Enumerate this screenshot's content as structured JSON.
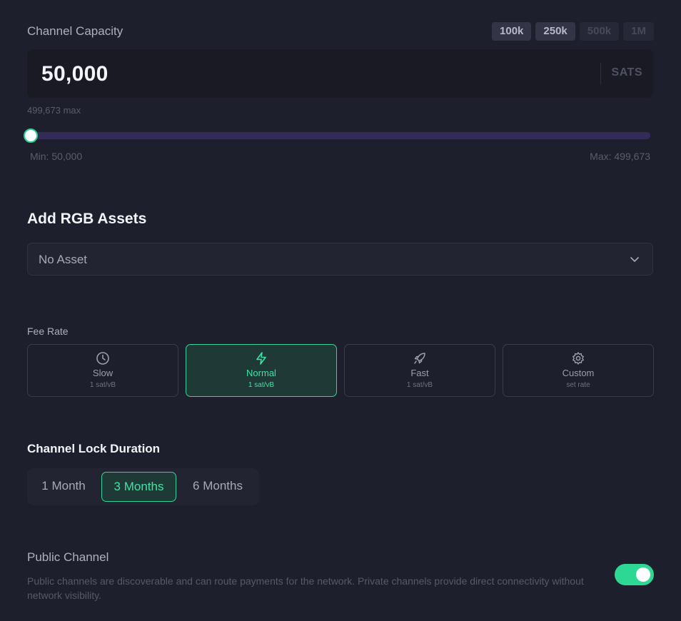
{
  "capacity": {
    "label": "Channel Capacity",
    "presets": [
      {
        "label": "100k",
        "enabled": true
      },
      {
        "label": "250k",
        "enabled": true
      },
      {
        "label": "500k",
        "enabled": false
      },
      {
        "label": "1M",
        "enabled": false
      }
    ],
    "value": "50,000",
    "unit": "SATS",
    "max_hint": "499,673 max",
    "slider": {
      "fraction": 0.0
    },
    "min_label": "Min: 50,000",
    "max_label": "Max: 499,673"
  },
  "rgb": {
    "title": "Add RGB Assets",
    "selected": "No Asset"
  },
  "fee": {
    "label": "Fee Rate",
    "options": [
      {
        "name": "Slow",
        "rate": "1 sat/vB",
        "icon": "clock-icon",
        "active": false
      },
      {
        "name": "Normal",
        "rate": "1 sat/vB",
        "icon": "lightning-icon",
        "active": true
      },
      {
        "name": "Fast",
        "rate": "1 sat/vB",
        "icon": "rocket-icon",
        "active": false
      },
      {
        "name": "Custom",
        "rate": "set rate",
        "icon": "gear-icon",
        "active": false
      }
    ]
  },
  "lock": {
    "title": "Channel Lock Duration",
    "options": [
      {
        "label": "1 Month",
        "active": false
      },
      {
        "label": "3 Months",
        "active": true
      },
      {
        "label": "6 Months",
        "active": false
      }
    ]
  },
  "public": {
    "title": "Public Channel",
    "description": "Public channels are discoverable and can route payments for the network. Private channels provide direct connectivity without network visibility.",
    "enabled": true
  },
  "colors": {
    "accent": "#35d39a",
    "background": "#1d1f2c",
    "slider_track": "#332c58"
  }
}
